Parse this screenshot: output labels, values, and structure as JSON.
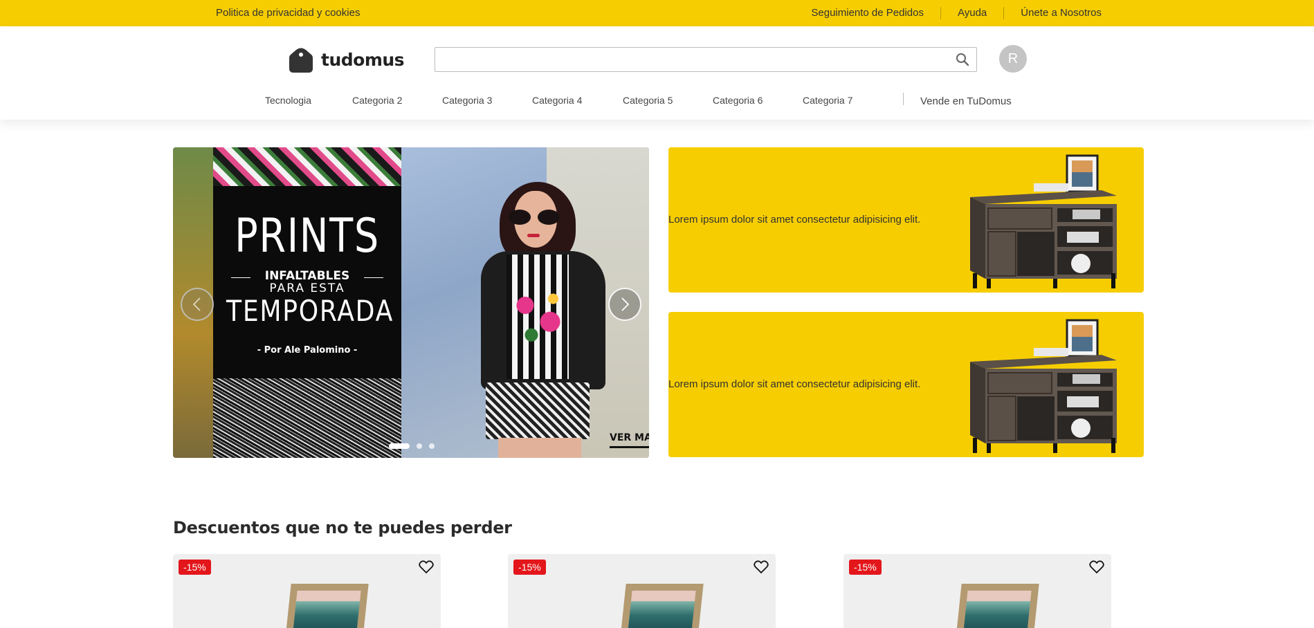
{
  "topbar": {
    "privacy_link": "Politica de privacidad y cookies",
    "links": [
      "Seguimiento de Pedidos",
      "Ayuda",
      "Únete a Nosotros"
    ],
    "background_color": "#f6cd00"
  },
  "header": {
    "logo_text": "tudomus",
    "search": {
      "value": "",
      "placeholder": "",
      "icon": "search-icon"
    },
    "avatar_initial": "R",
    "categories": [
      "Tecnologia",
      "Categoria 2",
      "Categoria 3",
      "Categoria 4",
      "Categoria 5",
      "Categoria 6",
      "Categoria 7"
    ],
    "sell_link": "Vende en TuDomus"
  },
  "hero": {
    "slide_title": "PRINTS",
    "slide_subtitle_1": "INFALTABLES",
    "slide_subtitle_2": "PARA ESTA",
    "slide_title_2": "TEMPORADA",
    "slide_byline": "- Por Ale Palomino -",
    "cta_label": "VER MA",
    "prev_icon": "chevron-left-icon",
    "next_icon": "chevron-right-icon",
    "slide_count": 3,
    "active_slide": 1
  },
  "banners": [
    {
      "text": "Lorem ipsum dolor sit amet consectetur adipisicing elit.",
      "image": "tv-stand-furniture"
    },
    {
      "text": "Lorem ipsum dolor sit amet consectetur adipisicing elit.",
      "image": "tv-stand-furniture"
    }
  ],
  "discounts": {
    "title": "Descuentos que no te puedes perder",
    "products": [
      {
        "badge": "-15%",
        "fav_icon": "heart-icon",
        "image": "framed-landscape-art"
      },
      {
        "badge": "-15%",
        "fav_icon": "heart-icon",
        "image": "framed-landscape-art"
      },
      {
        "badge": "-15%",
        "fav_icon": "heart-icon",
        "image": "framed-landscape-art"
      }
    ],
    "badge_color": "#e3161b"
  }
}
